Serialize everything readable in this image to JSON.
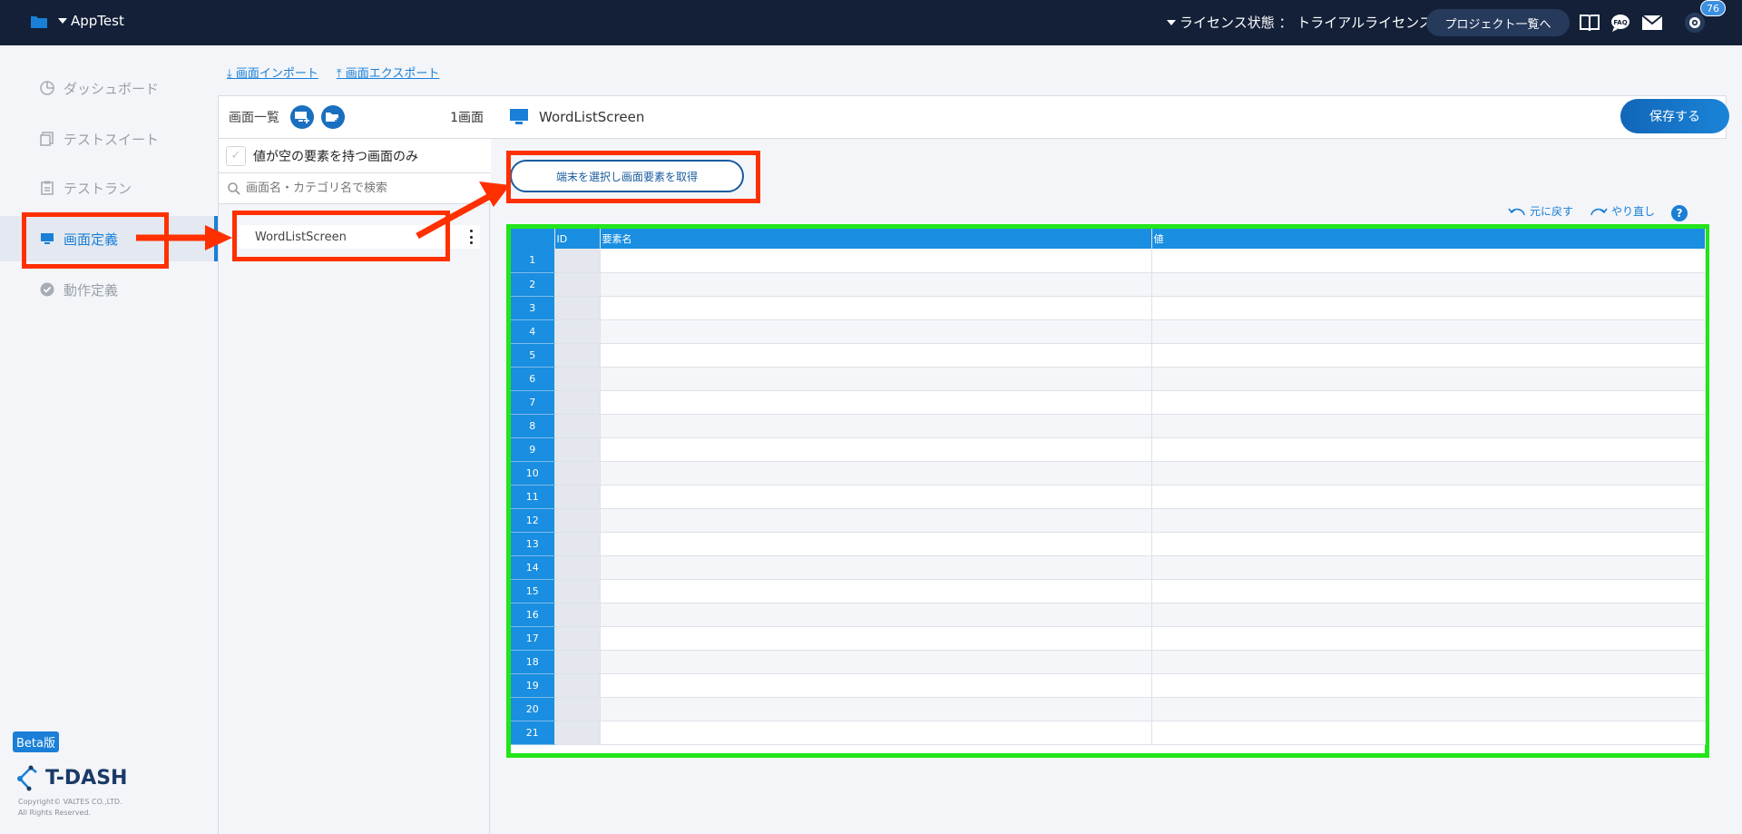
{
  "topbar": {
    "app_name": "AppTest",
    "license_text": "ライセンス状態 ： トライアルライセンス",
    "projects_button": "プロジェクト一覧へ",
    "notification_count": "76"
  },
  "sidebar": {
    "items": [
      {
        "label": "ダッシュボード",
        "icon": "dashboard-icon"
      },
      {
        "label": "テストスイート",
        "icon": "suite-icon"
      },
      {
        "label": "テストラン",
        "icon": "testrun-icon"
      },
      {
        "label": "画面定義",
        "icon": "monitor-icon"
      },
      {
        "label": "動作定義",
        "icon": "check-circle-icon"
      }
    ],
    "beta_label": "Beta版",
    "logo_text": "T-DASH",
    "copyright_line1": "Copyright© VALTES CO.,LTD.",
    "copyright_line2": "All Rights Reserved."
  },
  "top_links": {
    "import": "画面インポート",
    "export": "画面エクスポート"
  },
  "screen_list": {
    "title": "画面一覧",
    "count": "1画面",
    "filter_label": "値が空の要素を持つ画面のみ",
    "search_placeholder": "画面名・カテゴリ名で検索",
    "items": [
      "WordListScreen"
    ]
  },
  "main": {
    "screen_name": "WordListScreen",
    "save_button": "保存する",
    "fetch_button": "端末を選択し画面要素を取得",
    "undo_label": "元に戻す",
    "redo_label": "やり直し",
    "help_label": "?"
  },
  "grid": {
    "columns": [
      "ID",
      "要素名",
      "値"
    ],
    "row_numbers": [
      "1",
      "2",
      "3",
      "4",
      "5",
      "6",
      "7",
      "8",
      "9",
      "10",
      "11",
      "12",
      "13",
      "14",
      "15",
      "16",
      "17",
      "18",
      "19",
      "20",
      "21"
    ]
  },
  "colors": {
    "topbar": "#132038",
    "accent": "#1a7fd6",
    "annotation_red": "#ff3000",
    "annotation_green": "#22e51a"
  }
}
